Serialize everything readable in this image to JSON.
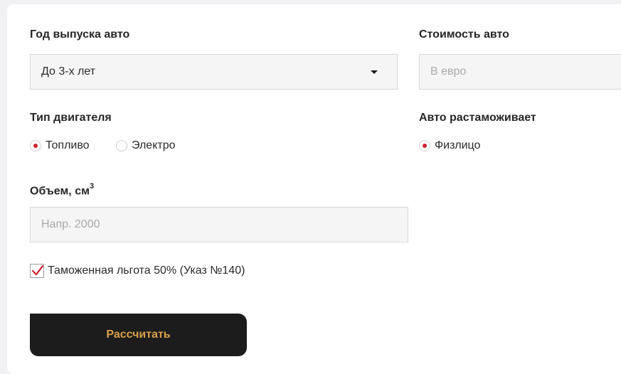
{
  "year": {
    "label": "Год выпуска авто",
    "selected": "До 3-х лет"
  },
  "price": {
    "label": "Стоимость авто",
    "placeholder": "В евро"
  },
  "engine": {
    "label": "Тип двигателя",
    "options": [
      {
        "label": "Топливо",
        "selected": true
      },
      {
        "label": "Электро",
        "selected": false
      }
    ]
  },
  "customs": {
    "label": "Авто растаможивает",
    "options": [
      {
        "label": "Физлицо",
        "selected": true
      }
    ]
  },
  "volume": {
    "label": "Объем, см",
    "sup": "3",
    "placeholder": "Напр. 2000"
  },
  "benefit": {
    "label": "Таможенная льгота 50% (Указ №140)",
    "checked": true
  },
  "submit": {
    "label": "Рассчитать"
  },
  "colors": {
    "accent": "#d0202a",
    "button_bg": "#1c1c1c",
    "button_text": "#d8a04a"
  }
}
